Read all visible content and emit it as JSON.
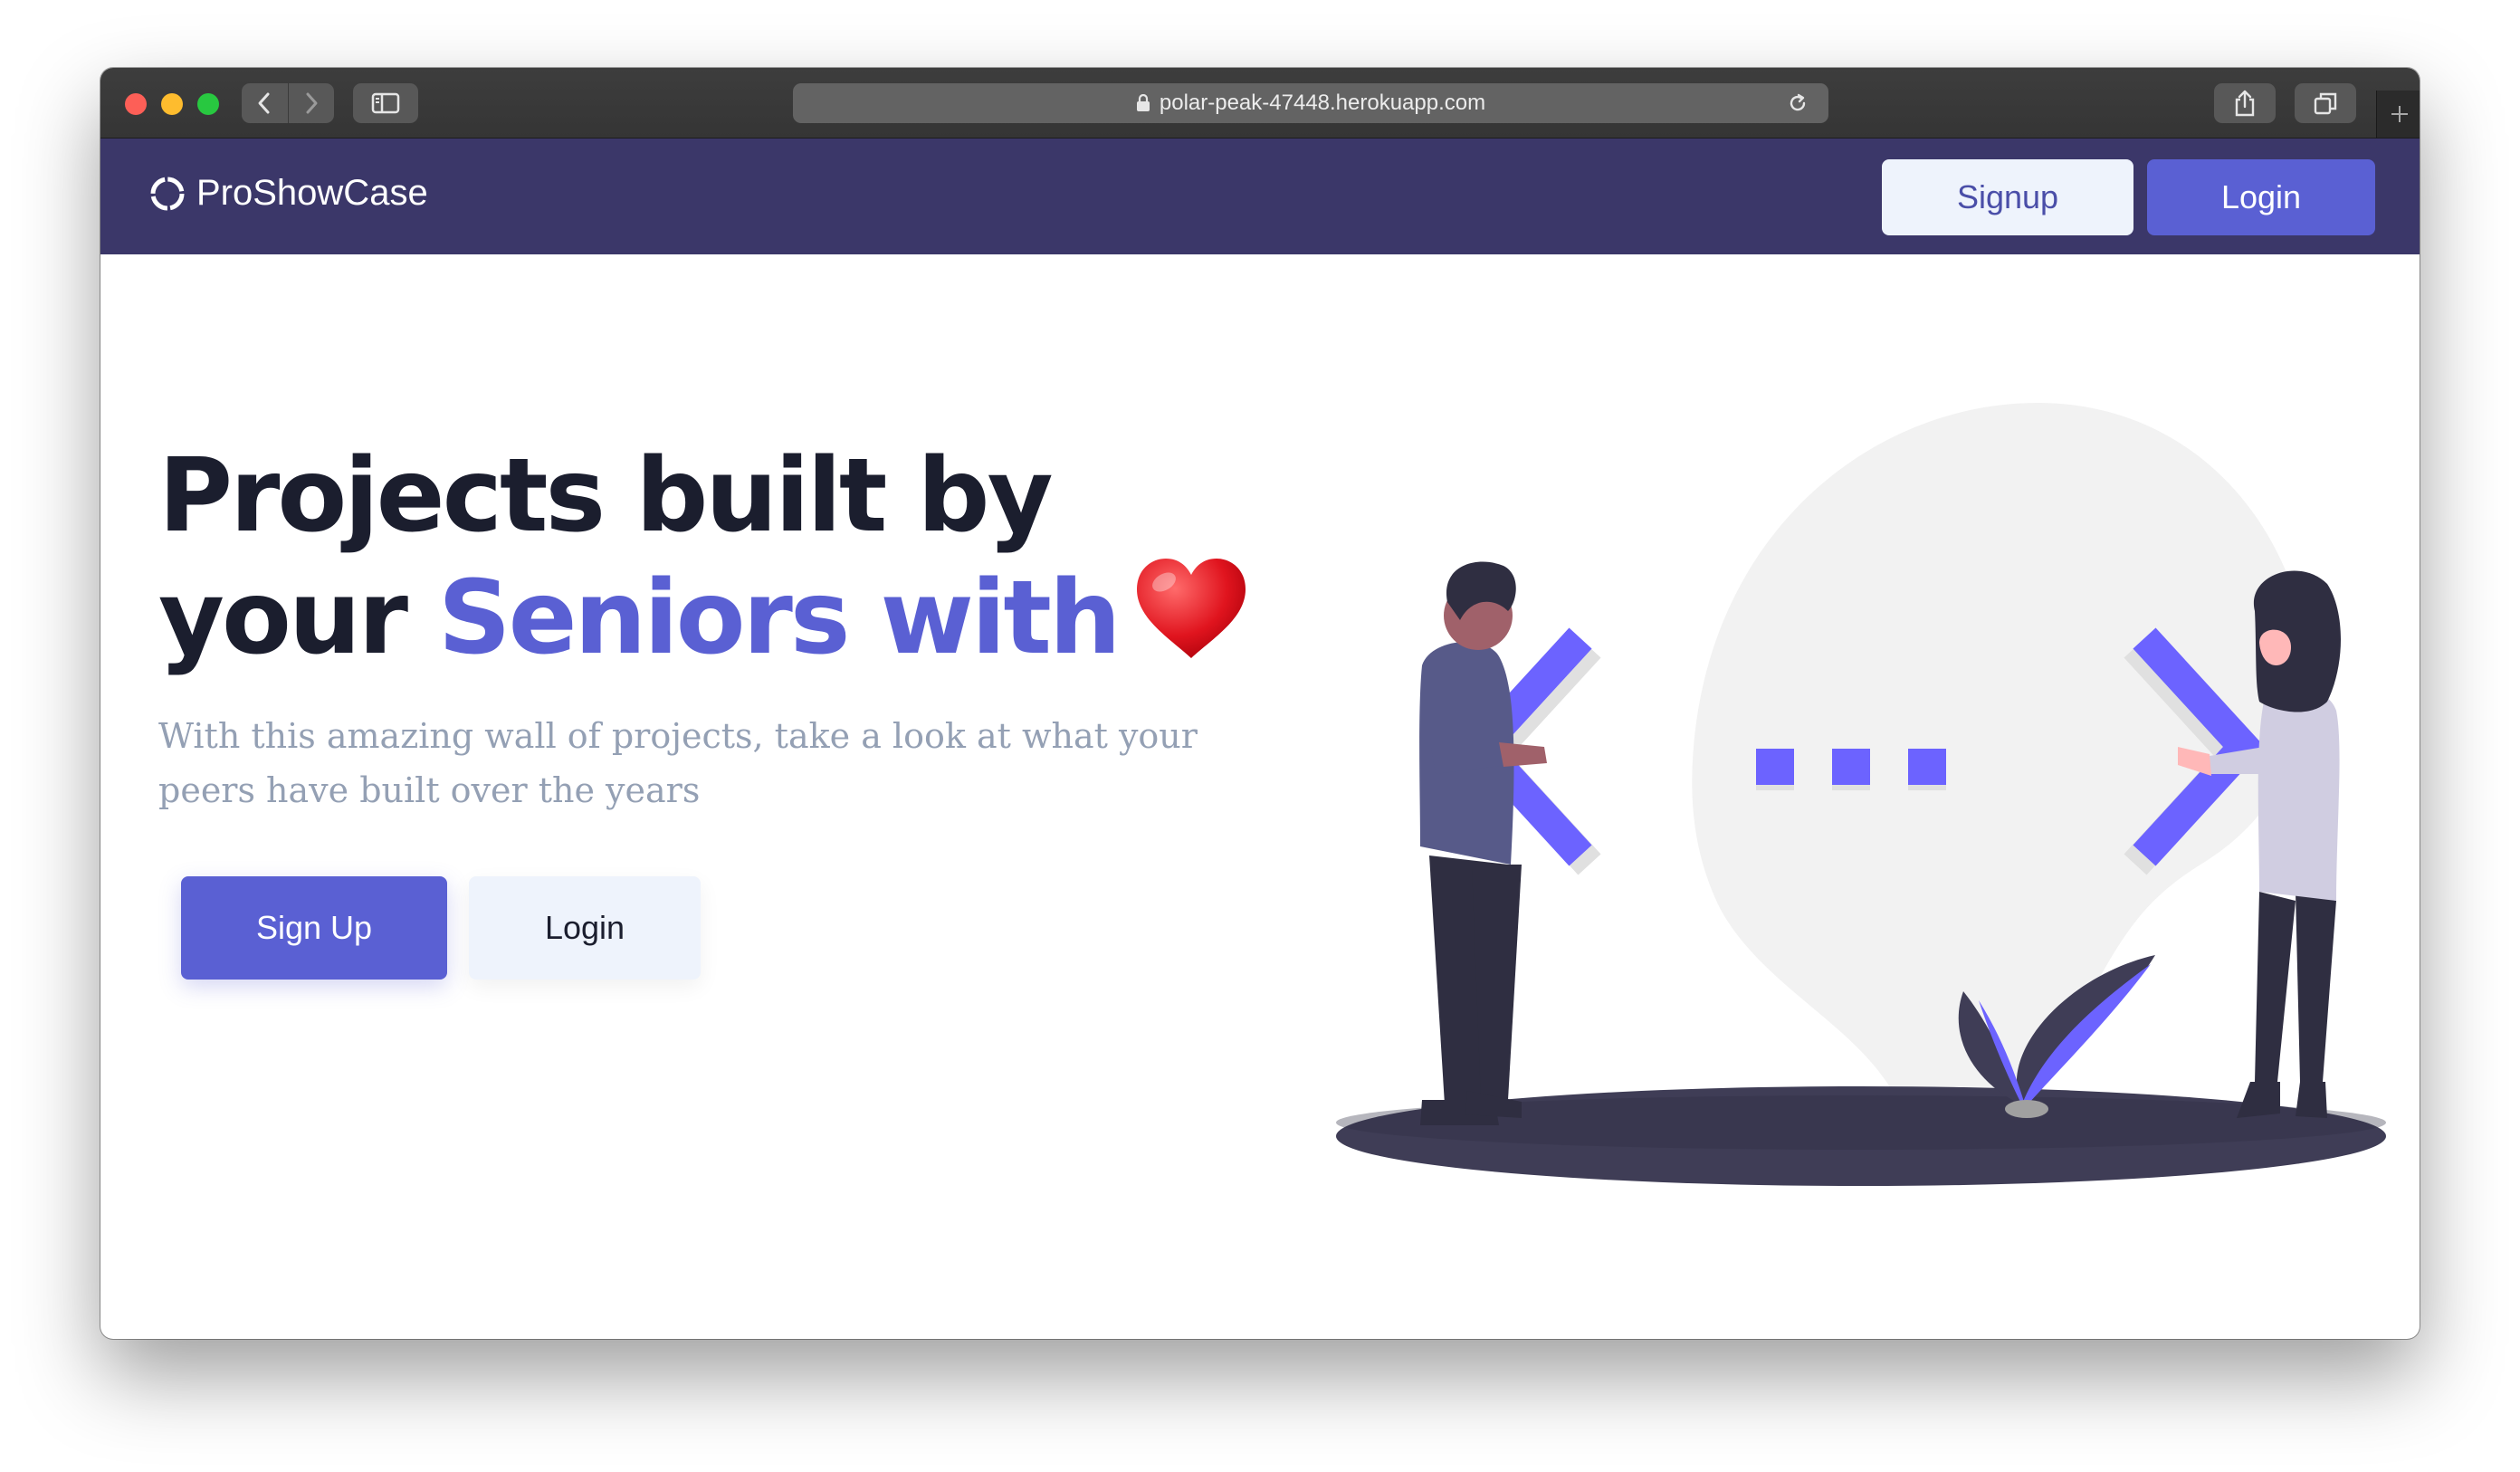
{
  "browser": {
    "url": "polar-peak-47448.herokuapp.com"
  },
  "navbar": {
    "brand": "ProShowCase",
    "signup_label": "Signup",
    "login_label": "Login"
  },
  "hero": {
    "title_line1": "Projects built by",
    "title_line2_prefix": "your ",
    "title_line2_accent": "Seniors with",
    "subtitle": "With this amazing wall of projects, take a look at what your peers have built over the years",
    "signup_button": "Sign Up",
    "login_button": "Login"
  },
  "icons": {
    "heart": "heart-icon",
    "lock": "lock-icon",
    "reload": "reload-icon",
    "logo": "logo-icon"
  },
  "colors": {
    "navbar_bg": "#3b3769",
    "accent": "#5a60d3",
    "light_button": "#eef3fc",
    "heading": "#1b1e2e",
    "subtitle": "#94a0b4",
    "illustration_accent": "#6c63ff"
  }
}
